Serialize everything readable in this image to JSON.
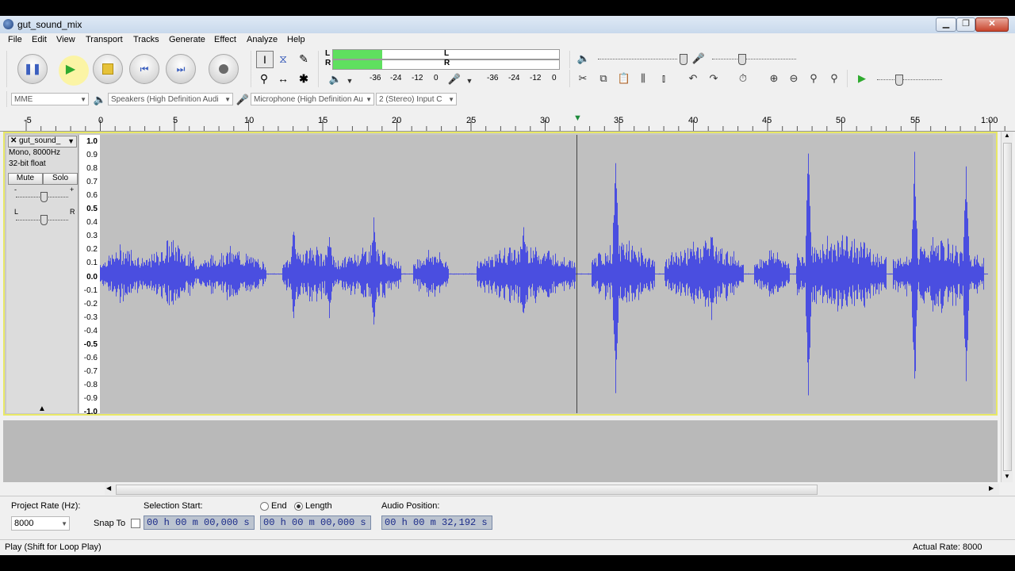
{
  "window": {
    "title": "gut_sound_mix"
  },
  "menu": [
    "File",
    "Edit",
    "View",
    "Transport",
    "Tracks",
    "Generate",
    "Effect",
    "Analyze",
    "Help"
  ],
  "meters": {
    "left_label": "L",
    "right_label": "R",
    "scale": [
      "-36",
      "-24",
      "-12",
      "0"
    ],
    "rec_scale": [
      "-36",
      "-24",
      "-12",
      "0"
    ],
    "play_level": 0.45
  },
  "device": {
    "host": "MME",
    "playback": "Speakers (High Definition Audi",
    "recording": "Microphone (High Definition Au",
    "channels": "2 (Stereo) Input C"
  },
  "ruler": {
    "ticks": [
      "-5",
      "0",
      "5",
      "10",
      "15",
      "20",
      "25",
      "30",
      "35",
      "40",
      "45",
      "50",
      "55",
      "1:00"
    ]
  },
  "track": {
    "name": "gut_sound_",
    "format": "Mono, 8000Hz",
    "bit_depth": "32-bit float",
    "mute": "Mute",
    "solo": "Solo",
    "gain_minus": "-",
    "gain_plus": "+",
    "pan_left": "L",
    "pan_right": "R",
    "scale": [
      "1.0",
      "0.9",
      "0.8",
      "0.7",
      "0.6",
      "0.5",
      "0.4",
      "0.3",
      "0.2",
      "0.1",
      "0.0",
      "-0.1",
      "-0.2",
      "-0.3",
      "-0.4",
      "-0.5",
      "-0.6",
      "-0.7",
      "-0.8",
      "-0.9",
      "-1.0"
    ],
    "wave_color": "#4a4ee0"
  },
  "selection": {
    "project_rate_label": "Project Rate (Hz):",
    "project_rate": "8000",
    "snap_label": "Snap To",
    "selection_start_label": "Selection Start:",
    "end_label": "End",
    "length_label": "Length",
    "audio_position_label": "Audio Position:",
    "selection_start": "00 h 00 m 00,000 s",
    "selection_length": "00 h 00 m 00,000 s",
    "audio_position": "00 h 00 m 32,192 s"
  },
  "status": {
    "left": "Play (Shift for Loop Play)",
    "right": "Actual Rate: 8000"
  }
}
